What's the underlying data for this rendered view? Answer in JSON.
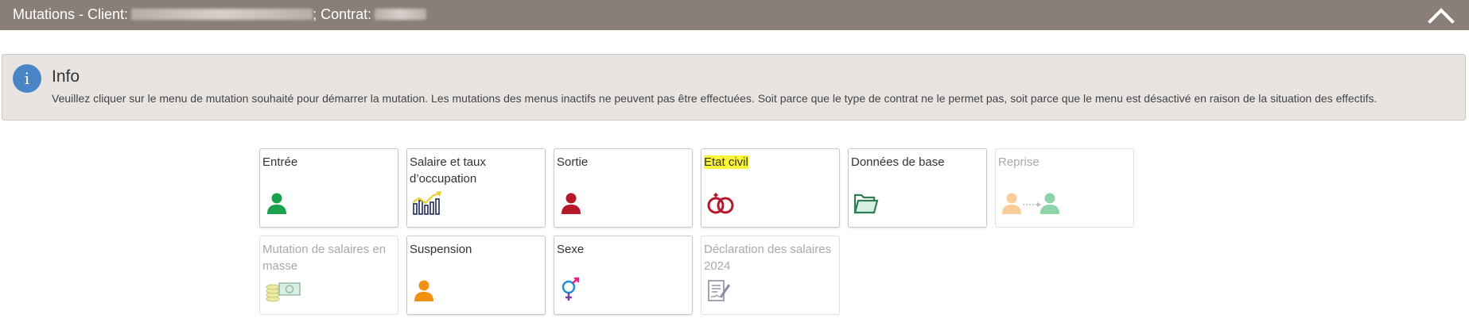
{
  "header": {
    "title_prefix": "Mutations - Client:",
    "title_mid": "; Contrat:",
    "client_redacted": "██████████████",
    "contract_redacted": "██████",
    "collapse_icon": "chevron-up-icon"
  },
  "info": {
    "icon": "info-icon",
    "icon_glyph": "i",
    "title": "Info",
    "text": "Veuillez cliquer sur le menu de mutation souhaité pour démarrer la mutation. Les mutations des menus inactifs ne peuvent pas être effectuées. Soit parce que le type de contrat ne le permet pas, soit parce que le menu est désactivé en raison de la situation des effectifs."
  },
  "tiles": [
    {
      "label": "Entrée",
      "icon": "person-green-icon",
      "active": true,
      "highlighted": false
    },
    {
      "label": "Salaire et taux d’occupation",
      "icon": "salary-chart-icon",
      "active": true,
      "highlighted": false
    },
    {
      "label": "Sortie",
      "icon": "person-red-icon",
      "active": true,
      "highlighted": false
    },
    {
      "label": "Etat civil",
      "icon": "wedding-rings-icon",
      "active": true,
      "highlighted": true
    },
    {
      "label": "Données de base",
      "icon": "folder-icon",
      "active": true,
      "highlighted": false
    },
    {
      "label": "Reprise",
      "icon": "transfer-persons-icon",
      "active": false,
      "highlighted": false
    },
    {
      "label": "Mutation de salaires en masse",
      "icon": "money-coins-icon",
      "active": false,
      "highlighted": false
    },
    {
      "label": "Suspension",
      "icon": "person-orange-icon",
      "active": true,
      "highlighted": false
    },
    {
      "label": "Sexe",
      "icon": "gender-icon",
      "active": true,
      "highlighted": false
    },
    {
      "label": "Déclaration des salaires 2024",
      "icon": "salary-declaration-icon",
      "active": false,
      "highlighted": false
    }
  ],
  "colors": {
    "header_bg": "#8a7f78",
    "info_bg": "#e8e4e2",
    "info_icon": "#4a86c5",
    "highlight": "#fbf53a",
    "green": "#1aa34a",
    "red": "#b5182b",
    "orange": "#f29111",
    "navy": "#1f2a5a"
  }
}
